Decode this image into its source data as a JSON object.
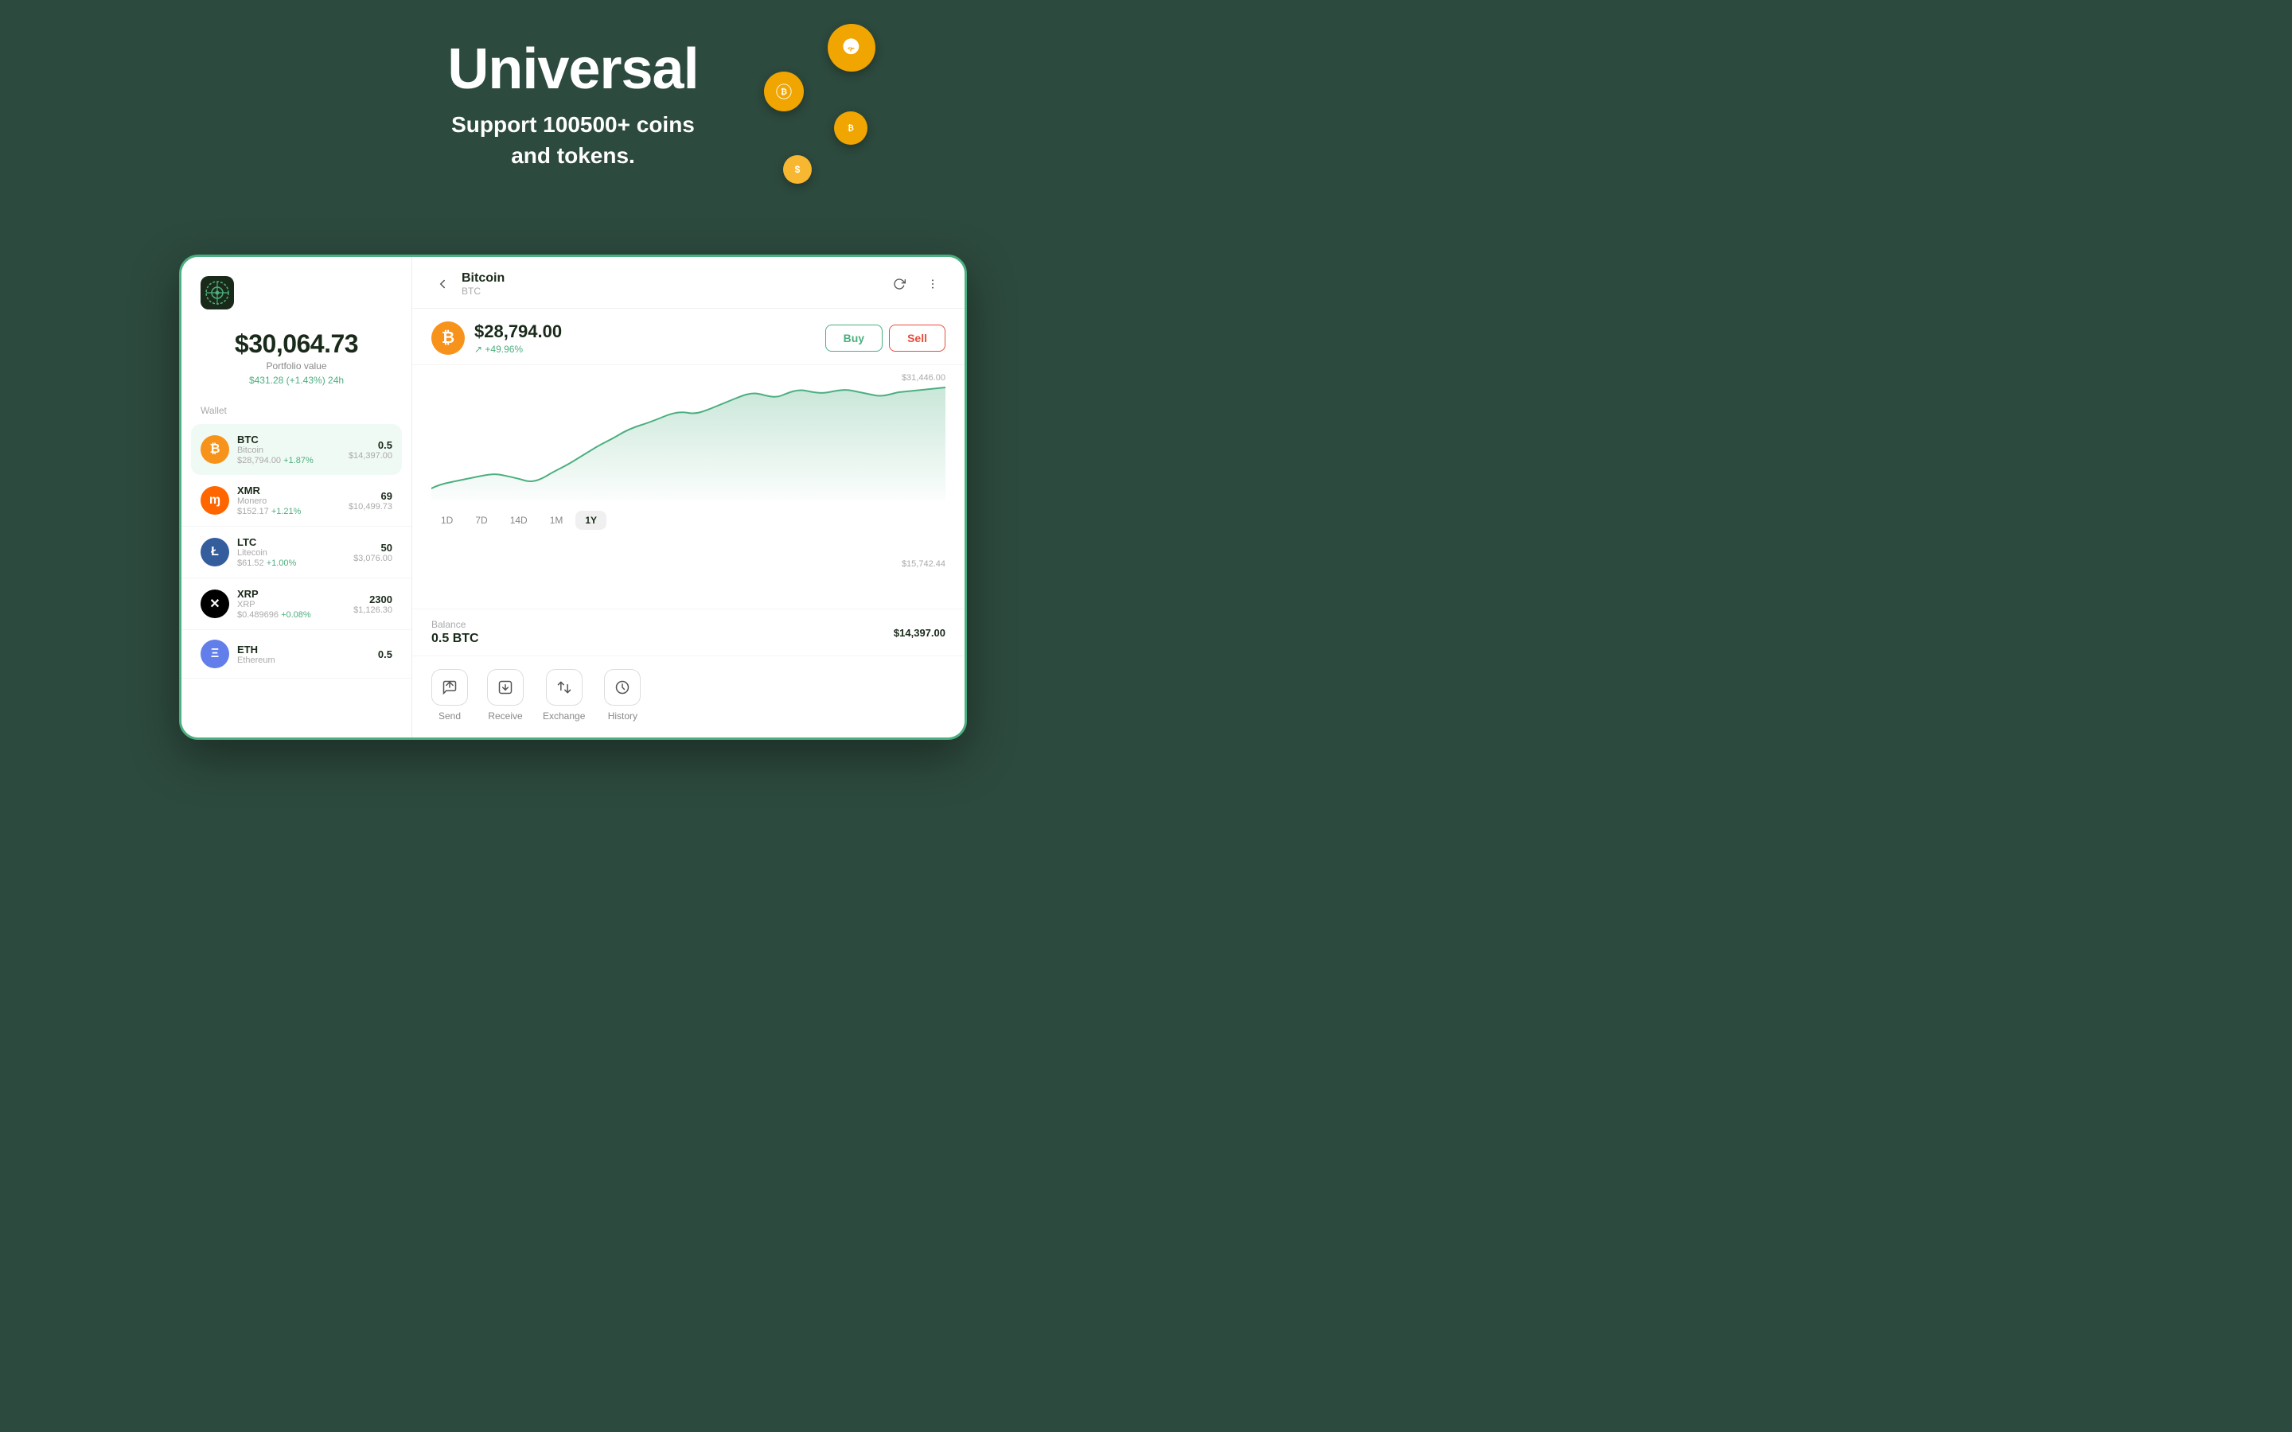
{
  "hero": {
    "title": "Universal",
    "subtitle_line1": "Support 100500+ coins",
    "subtitle_line2": "and tokens."
  },
  "coins_floating": [
    {
      "symbol": "₿",
      "size": "lg"
    },
    {
      "symbol": "₿",
      "size": "md"
    },
    {
      "symbol": "₿",
      "size": "sm"
    },
    {
      "symbol": "$",
      "size": "xs"
    }
  ],
  "left_panel": {
    "portfolio_value": "$30,064.73",
    "portfolio_label": "Portfolio value",
    "portfolio_change": "$431.28 (+1.43%) 24h",
    "wallet_section_label": "Wallet",
    "coins": [
      {
        "symbol": "BTC",
        "name": "Bitcoin",
        "price": "$28,794.00",
        "change": "+1.87%",
        "amount": "0.5",
        "usd_value": "$14,397.00",
        "type": "btc",
        "active": true
      },
      {
        "symbol": "XMR",
        "name": "Monero",
        "price": "$152.17",
        "change": "+1.21%",
        "amount": "69",
        "usd_value": "$10,499.73",
        "type": "xmr",
        "active": false
      },
      {
        "symbol": "LTC",
        "name": "Litecoin",
        "price": "$61.52",
        "change": "+1.00%",
        "amount": "50",
        "usd_value": "$3,076.00",
        "type": "ltc",
        "active": false
      },
      {
        "symbol": "XRP",
        "name": "XRP",
        "price": "$0.489696",
        "change": "+0.08%",
        "amount": "2300",
        "usd_value": "$1,126.30",
        "type": "xrp",
        "active": false
      },
      {
        "symbol": "ETH",
        "name": "Ethereum",
        "price": "",
        "change": "",
        "amount": "0.5",
        "usd_value": "",
        "type": "eth",
        "active": false
      }
    ]
  },
  "right_panel": {
    "coin_name": "Bitcoin",
    "coin_symbol": "BTC",
    "current_price": "$28,794.00",
    "price_change": "↗ +49.96%",
    "price_high": "$31,446.00",
    "price_low": "$15,742.44",
    "buy_label": "Buy",
    "sell_label": "Sell",
    "time_filters": [
      "1D",
      "7D",
      "14D",
      "1M",
      "1Y"
    ],
    "active_filter": "1Y",
    "balance_label": "Balance",
    "balance_amount": "0.5 BTC",
    "balance_usd": "$14,397.00",
    "actions": [
      {
        "label": "Send",
        "icon": "send"
      },
      {
        "label": "Receive",
        "icon": "receive"
      },
      {
        "label": "Exchange",
        "icon": "exchange"
      },
      {
        "label": "History",
        "icon": "history"
      }
    ]
  }
}
